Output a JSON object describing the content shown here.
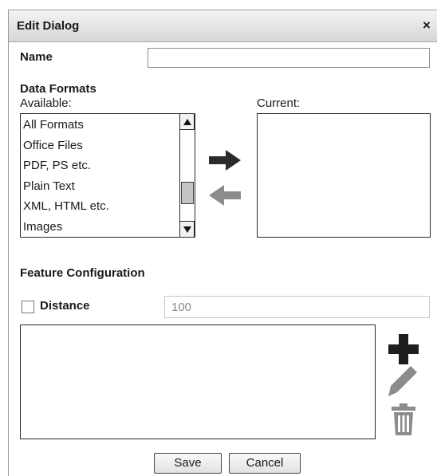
{
  "dialog": {
    "title": "Edit Dialog",
    "close_label": "×"
  },
  "name_field": {
    "label": "Name",
    "value": "",
    "placeholder": ""
  },
  "data_formats": {
    "heading": "Data Formats",
    "available_label": "Available:",
    "current_label": "Current:",
    "available_items": [
      "All Formats",
      "Office Files",
      "PDF, PS etc.",
      "Plain Text",
      "XML, HTML etc.",
      "Images"
    ],
    "current_items": [],
    "scroll_position": 0.75
  },
  "feature_configuration": {
    "heading": "Feature Configuration",
    "distance_label": "Distance",
    "distance_checked": false,
    "distance_value": "100",
    "items": []
  },
  "buttons": {
    "save": "Save",
    "cancel": "Cancel"
  },
  "icons": {
    "add": "plus-icon",
    "edit": "pencil-icon",
    "delete": "trash-icon",
    "move_right": "arrow-right-icon",
    "move_left": "arrow-left-icon"
  },
  "colors": {
    "arrow_active": "#2b2b2b",
    "arrow_inactive": "#8c8c8c",
    "add_icon": "#1e1e1e",
    "muted_icon": "#8c8c8c"
  }
}
